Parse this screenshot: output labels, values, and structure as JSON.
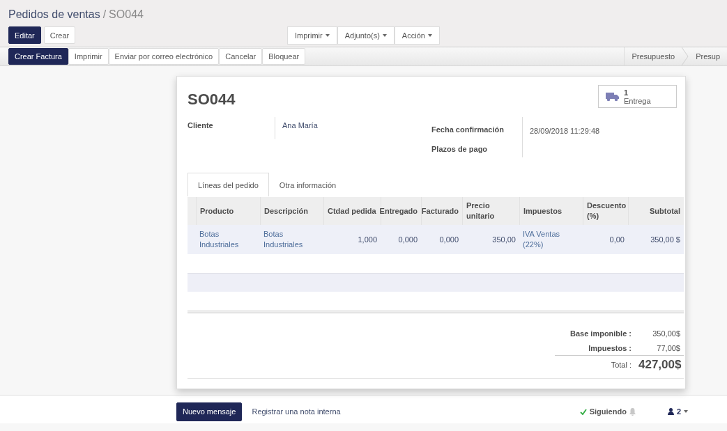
{
  "breadcrumb": {
    "parent": "Pedidos de ventas",
    "separator": "/",
    "current": "SO044"
  },
  "edit_buttons": [
    {
      "label": "Editar",
      "primary": true
    },
    {
      "label": "Crear",
      "primary": false
    }
  ],
  "dropdowns": [
    "Imprimir",
    "Adjunto(s)",
    "Acción"
  ],
  "action_buttons": [
    {
      "label": "Crear Factura",
      "primary": true
    },
    {
      "label": "Imprimir",
      "primary": false
    },
    {
      "label": "Enviar por correo electrónico",
      "primary": false
    },
    {
      "label": "Cancelar",
      "primary": false
    },
    {
      "label": "Bloquear",
      "primary": false
    }
  ],
  "status_stages": [
    "Presupuesto",
    "Presup"
  ],
  "record": {
    "name": "SO044",
    "smart_button": {
      "count": "1",
      "label": "Entrega"
    },
    "fields_left": [
      {
        "label": "Cliente",
        "value": "Ana María"
      }
    ],
    "fields_right": [
      {
        "label": "Fecha confirmación",
        "value": "28/09/2018 11:29:48"
      },
      {
        "label": "Plazos de pago"
      }
    ]
  },
  "tabs": [
    {
      "label": "Líneas del pedido",
      "selected": true
    },
    {
      "label": "Otra información",
      "selected": false
    }
  ],
  "table": {
    "columns": [
      {
        "label": "Producto",
        "kind": "text"
      },
      {
        "label": "Descripción",
        "kind": "text"
      },
      {
        "label": "Ctdad pedida",
        "kind": "number"
      },
      {
        "label": "Entregado",
        "kind": "number"
      },
      {
        "label": "Facturado",
        "kind": "number"
      },
      {
        "label": "Precio unitario",
        "kind": "number"
      },
      {
        "label": "Impuestos",
        "kind": "text"
      },
      {
        "label": "Descuento (%)",
        "kind": "number"
      },
      {
        "label": "Subtotal",
        "kind": "number"
      }
    ],
    "rows": [
      [
        "Botas Industriales",
        "Botas Industriales",
        "1,000",
        "0,000",
        "0,000",
        "350,00",
        "IVA Ventas (22%)",
        "0,00",
        "350,00 $"
      ]
    ]
  },
  "totals": [
    {
      "label": "Base imponible :",
      "value": "350,00$",
      "grand": false
    },
    {
      "label": "Impuestos :",
      "value": "77,00$",
      "grand": false
    },
    {
      "label": "Total :",
      "value": "427,00$",
      "grand": true
    }
  ],
  "chatter": {
    "new_message": "Nuevo mensaje",
    "log_note": "Registrar una nota interna",
    "following": "Siguiendo",
    "followers": "2"
  }
}
